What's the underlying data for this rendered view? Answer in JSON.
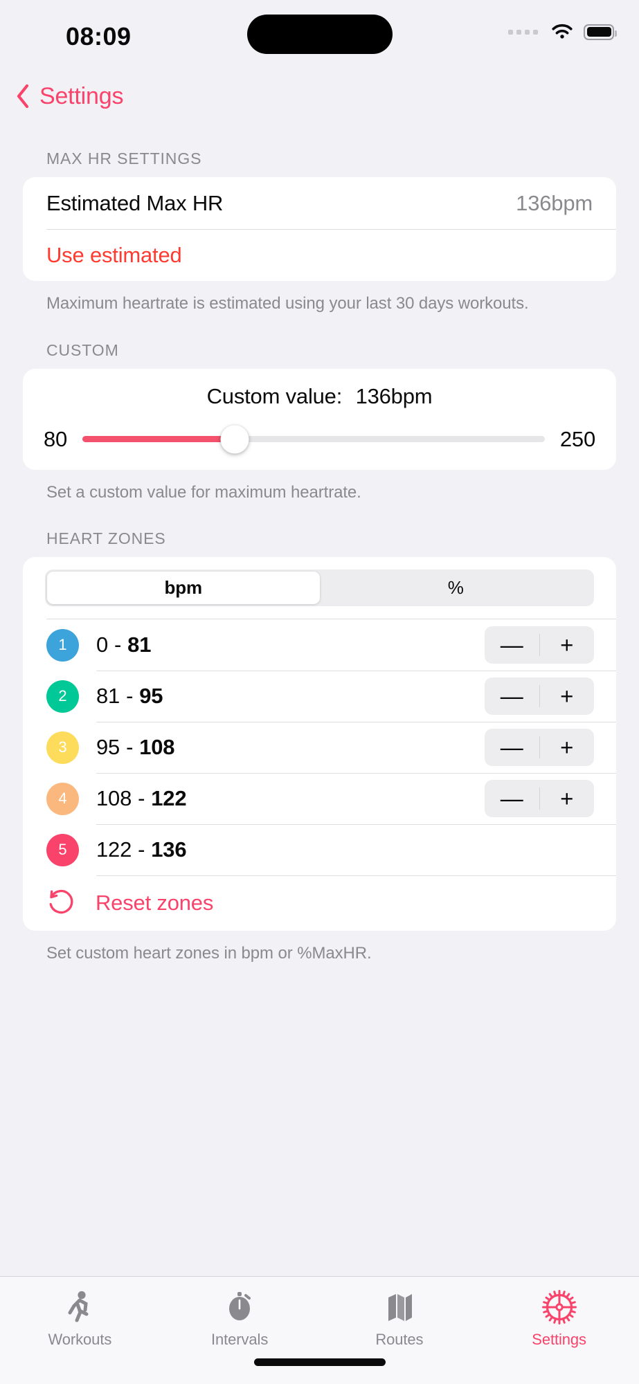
{
  "status_bar": {
    "time": "08:09",
    "signal_icon": "signal-dots-icon",
    "wifi_icon": "wifi-icon",
    "battery_icon": "battery-icon"
  },
  "navbar": {
    "back_icon": "chevron-left-icon",
    "back_label": "Settings"
  },
  "colors": {
    "accent_pink": "#F9436B",
    "destructive_red": "#FD3B30",
    "slider_fill": "#F4516C",
    "page_background": "#F2F1F6",
    "card_background": "#FFFFFF",
    "secondary_text": "#8A8A8E"
  },
  "max_hr_section": {
    "header": "MAX HR SETTINGS",
    "estimated_label": "Estimated Max HR",
    "estimated_value": "136bpm",
    "use_estimated_label": "Use estimated",
    "footnote": "Maximum heartrate is estimated using your last 30 days workouts."
  },
  "custom_section": {
    "header": "CUSTOM",
    "title_label": "Custom value:",
    "title_value": "136bpm",
    "slider": {
      "min_label": "80",
      "max_label": "250",
      "min": 80,
      "max": 250,
      "value": 136,
      "percent": 33
    },
    "footnote": "Set a custom value for maximum heartrate."
  },
  "heart_zones_section": {
    "header": "HEART ZONES",
    "unit_toggle": {
      "options": [
        "bpm",
        "%"
      ],
      "selected": "bpm"
    },
    "zones": [
      {
        "number": "1",
        "from": "0",
        "dash": "-",
        "to": "81",
        "color": "#3DA4DB",
        "stepper": true,
        "minus": "—",
        "plus": "+"
      },
      {
        "number": "2",
        "from": "81",
        "dash": "-",
        "to": "95",
        "color": "#00C896",
        "stepper": true,
        "minus": "—",
        "plus": "+"
      },
      {
        "number": "3",
        "from": "95",
        "dash": "-",
        "to": "108",
        "color": "#FDDC5C",
        "stepper": true,
        "minus": "—",
        "plus": "+"
      },
      {
        "number": "4",
        "from": "108",
        "dash": "-",
        "to": "122",
        "color": "#FBB87E",
        "stepper": true,
        "minus": "—",
        "plus": "+"
      },
      {
        "number": "5",
        "from": "122",
        "dash": "-",
        "to": "136",
        "color": "#F9436B",
        "stepper": false,
        "minus": "",
        "plus": ""
      }
    ],
    "reset": {
      "icon": "undo-arrow-icon",
      "label": "Reset zones"
    },
    "footnote": "Set custom heart zones in bpm or %MaxHR."
  },
  "tabbar": {
    "tabs": [
      {
        "label": "Workouts",
        "icon": "running-person-icon",
        "active": false
      },
      {
        "label": "Intervals",
        "icon": "stopwatch-icon",
        "active": false
      },
      {
        "label": "Routes",
        "icon": "folded-map-icon",
        "active": false
      },
      {
        "label": "Settings",
        "icon": "gear-icon",
        "active": true
      }
    ]
  }
}
